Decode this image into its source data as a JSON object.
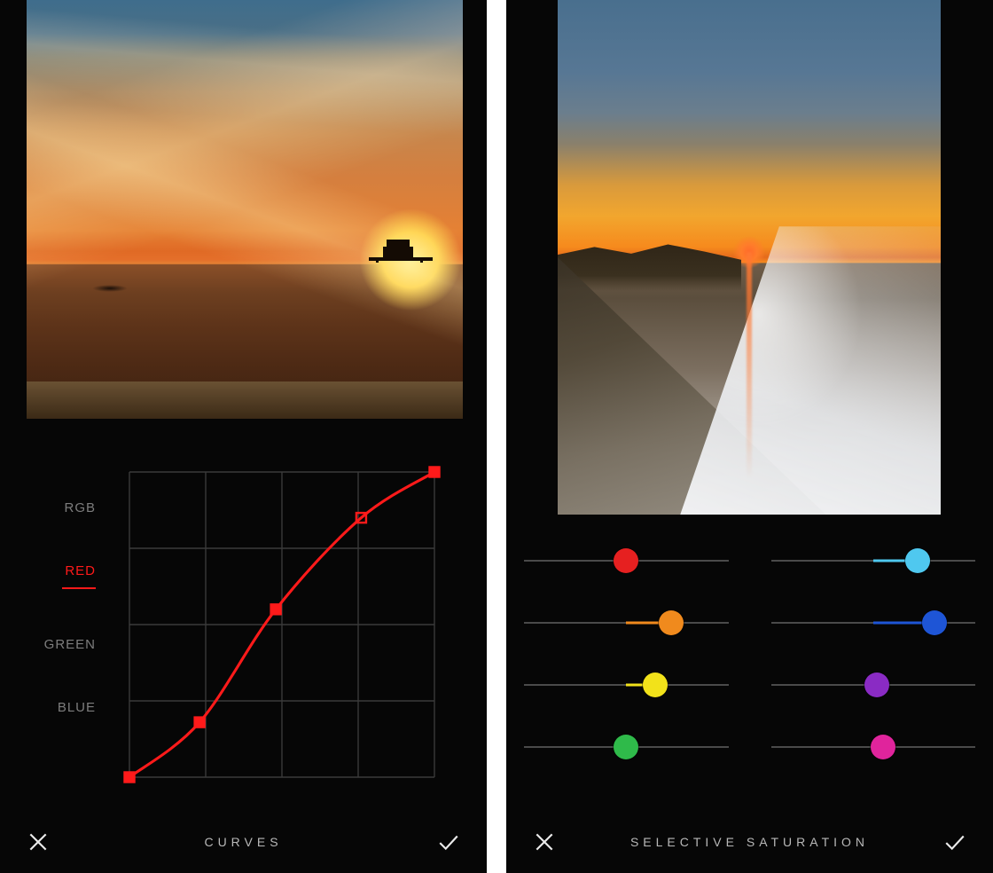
{
  "left": {
    "title": "CURVES",
    "channels": [
      "RGB",
      "RED",
      "GREEN",
      "BLUE"
    ],
    "active_channel_index": 1,
    "active_color": "#ff1a1a",
    "curve_points": [
      {
        "x": 0.0,
        "y": 0.0,
        "filled": true
      },
      {
        "x": 0.23,
        "y": 0.18,
        "filled": true
      },
      {
        "x": 0.48,
        "y": 0.55,
        "filled": true
      },
      {
        "x": 0.76,
        "y": 0.85,
        "filled": false
      },
      {
        "x": 1.0,
        "y": 1.0,
        "filled": true
      }
    ],
    "grid_divisions": 4
  },
  "right": {
    "title": "SELECTIVE SATURATION",
    "sliders": [
      {
        "name": "red",
        "color": "#e62020",
        "value": 0.5
      },
      {
        "name": "cyan",
        "color": "#4fc8ef",
        "value": 0.72
      },
      {
        "name": "orange",
        "color": "#f08a1d",
        "value": 0.72
      },
      {
        "name": "blue",
        "color": "#1e55d6",
        "value": 0.8
      },
      {
        "name": "yellow",
        "color": "#f2e21a",
        "value": 0.64
      },
      {
        "name": "purple",
        "color": "#8a2bc4",
        "value": 0.52
      },
      {
        "name": "green",
        "color": "#2fba4a",
        "value": 0.5
      },
      {
        "name": "magenta",
        "color": "#e0249c",
        "value": 0.55
      }
    ]
  },
  "icons": {
    "close": "close-icon",
    "confirm": "check-icon"
  }
}
